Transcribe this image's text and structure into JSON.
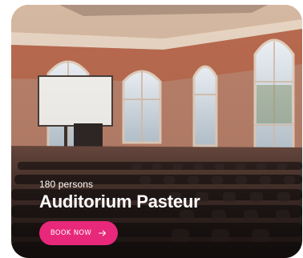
{
  "venue": {
    "capacity": "180 persons",
    "name": "Auditorium Pasteur"
  },
  "cta": {
    "label": "BOOK NOW",
    "icon": "arrow-right-icon"
  },
  "colors": {
    "accent": "#e8287a",
    "text": "#ffffff"
  }
}
